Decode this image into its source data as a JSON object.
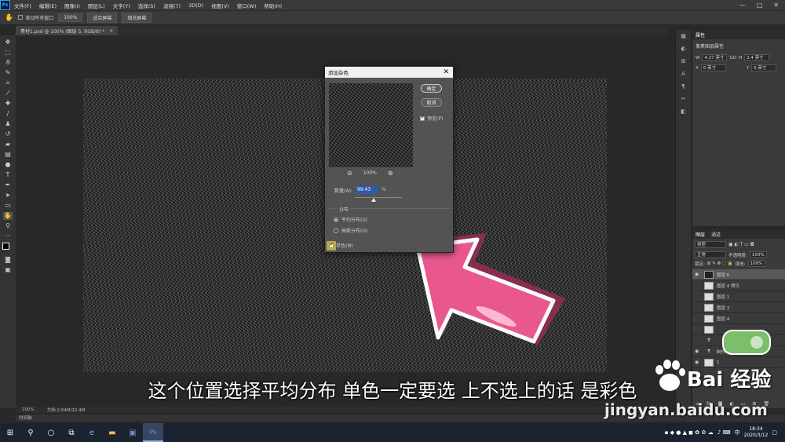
{
  "app": {
    "logo": "Ps"
  },
  "menu": [
    "文件(F)",
    "编辑(E)",
    "图像(I)",
    "图层(L)",
    "文字(Y)",
    "选择(S)",
    "滤镜(T)",
    "3D(D)",
    "视图(V)",
    "窗口(W)",
    "帮助(H)"
  ],
  "window_controls": [
    "—",
    "□",
    "✕"
  ],
  "options_bar": {
    "scroll_all": "滚动所有窗口",
    "zoom": "100%",
    "fit_screen": "适合屏幕",
    "fill_screen": "填充屏幕"
  },
  "document_tab": {
    "title": "素材1.psd @ 100% (图层 5, RGB/8) *",
    "close": "×"
  },
  "tools_icons": [
    "move-icon",
    "marquee-icon",
    "lasso-icon",
    "quick-select-icon",
    "crop-icon",
    "eyedropper-icon",
    "healing-icon",
    "brush-icon",
    "stamp-icon",
    "history-brush-icon",
    "eraser-icon",
    "gradient-icon",
    "blur-icon",
    "dodge-icon",
    "pen-icon",
    "type-icon",
    "path-select-icon",
    "shape-icon",
    "hand-icon",
    "zoom-icon"
  ],
  "dialog": {
    "title": "添加杂色",
    "close": "✕",
    "ok": "确定",
    "cancel": "取消",
    "preview_label": "预览(P)",
    "zoom_level": "100%",
    "zoom_out": "⊖",
    "zoom_in": "⊕",
    "amount_label": "数量(A):",
    "amount_value": "99.43",
    "percent": "%",
    "amount_slider_fraction": 0.4,
    "distribution_label": "分布",
    "uniform_label": "平均分布(U)",
    "gaussian_label": "高斯分布(G)",
    "mono_label": "单色(M)",
    "uniform_selected": true,
    "mono_checked": true,
    "preview_checked": true
  },
  "properties_panel": {
    "tab": "属性",
    "type": "像素图层属性",
    "w": "4.27 英寸",
    "go": "GO",
    "h": "2.4 英寸",
    "x": "0 英寸",
    "y": "0 英寸"
  },
  "layers_panel": {
    "tab_layers": "图层",
    "tab_channels": "通道",
    "kind_filter": "类型",
    "blend_mode": "正常",
    "opacity_label": "不透明度:",
    "opacity": "100%",
    "lock_label": "锁定:",
    "fill_label": "填充:",
    "fill": "100%",
    "layers": [
      {
        "name": "图层 6",
        "visible": true,
        "selected": true,
        "kind": "dark"
      },
      {
        "name": "图层 4 拷贝",
        "visible": false,
        "selected": false,
        "kind": "light"
      },
      {
        "name": "图层 1",
        "visible": false,
        "selected": false,
        "kind": "light"
      },
      {
        "name": "图层 3",
        "visible": false,
        "selected": false,
        "kind": "light"
      },
      {
        "name": "图层 4",
        "visible": false,
        "selected": false,
        "kind": "light"
      },
      {
        "name": "",
        "visible": false,
        "selected": false,
        "kind": "light"
      },
      {
        "name": "",
        "visible": false,
        "selected": false,
        "kind": "text"
      },
      {
        "name": "制作跑笔子",
        "visible": true,
        "selected": false,
        "kind": "text"
      },
      {
        "name": "1",
        "visible": true,
        "selected": false,
        "kind": "light"
      }
    ]
  },
  "status": {
    "zoom": "100%",
    "doc": "文档:2.64M/22.4M",
    "timeline": "时间轴"
  },
  "taskbar": {
    "time": "18:34",
    "date": "2020/3/12",
    "lang": "中"
  },
  "subtitle": "这个位置选择平均分布 单色一定要选 上不选上的话 是彩色",
  "watermark": {
    "brand": "Bai 经验",
    "url": "jingyan.baidu.com"
  },
  "colors": {
    "arrow_pink": "#e8588f",
    "arrow_outline": "#ffffff",
    "badge_green": "#7bbf6a"
  }
}
